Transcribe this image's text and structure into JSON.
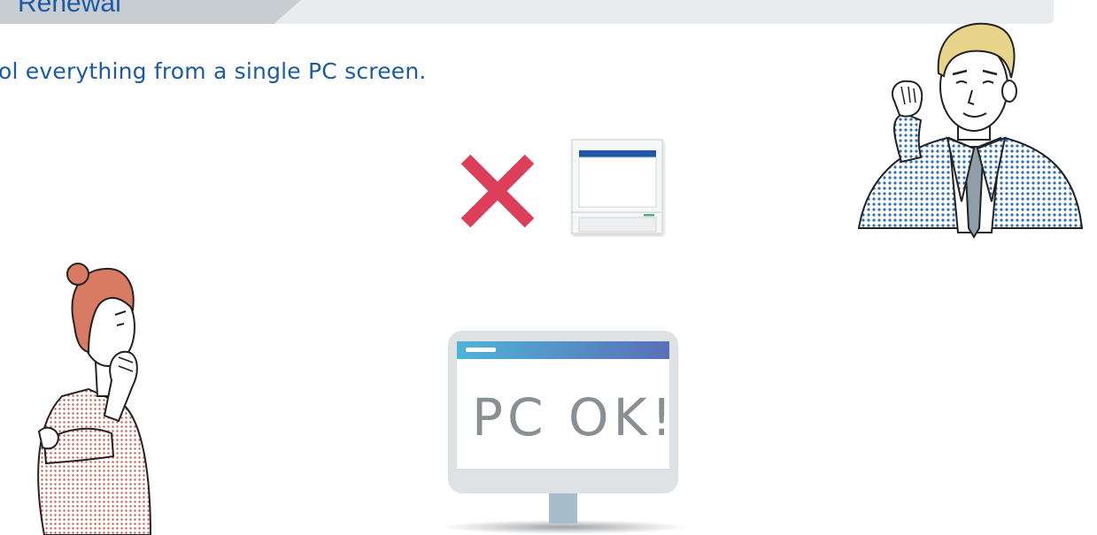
{
  "header": {
    "title": "Renewal"
  },
  "subtitle": "ol everything from a single PC screen.",
  "legacy_device": {
    "status": "not-supported",
    "icon": "cross-icon",
    "cross_color": "#dd3e5a"
  },
  "pc_screen": {
    "text": "PC OK!",
    "gradient_start": "#4fb3d7",
    "gradient_end": "#5a6fb8"
  },
  "colors": {
    "brand_blue": "#1b5aa6",
    "header_band": "#e9ecef",
    "header_tab": "#c8cdd2"
  }
}
